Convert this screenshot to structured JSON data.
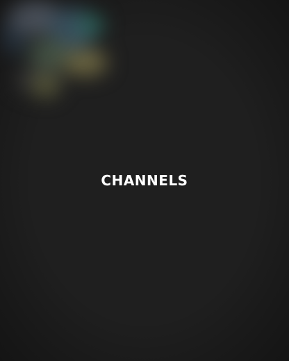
{
  "screen": {
    "title": "CHANNELS",
    "background_color": "#1f1f1f",
    "title_color": "#ffffff"
  }
}
